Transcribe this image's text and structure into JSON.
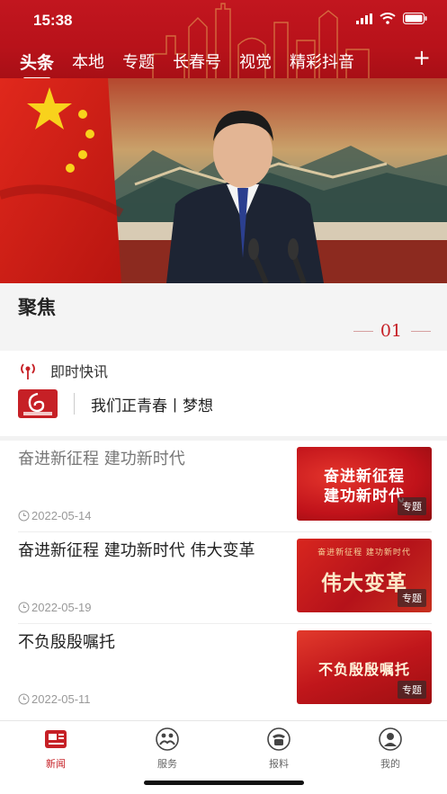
{
  "status_bar": {
    "time": "15:38"
  },
  "header": {
    "tabs": [
      "头条",
      "本地",
      "专题",
      "长春号",
      "视觉",
      "精彩抖音"
    ],
    "add_label": "+",
    "active_tab": "头条",
    "colors": {
      "brand_red": "#c2161f"
    }
  },
  "focus": {
    "title": "聚焦",
    "index": "01"
  },
  "flash": {
    "label": "即时快讯",
    "text": "我们正青春丨梦想"
  },
  "news": [
    {
      "title": "奋进新征程  建功新时代",
      "date": "2022-05-14",
      "thumb_line1": "奋进新征程",
      "thumb_line2": "建功新时代",
      "badge": "专题"
    },
    {
      "title": "奋进新征程  建功新时代  伟大变革",
      "date": "2022-05-19",
      "thumb_line1": "奋进新征程  建功新时代",
      "thumb_line2": "伟大变革",
      "badge": "专题"
    },
    {
      "title": "不负殷殷嘱托",
      "date": "2022-05-11",
      "thumb_line1": "不负殷殷嘱托",
      "thumb_line2": "",
      "badge": "专题"
    }
  ],
  "bottom_nav": [
    {
      "label": "新闻",
      "icon": "newspaper-icon"
    },
    {
      "label": "服务",
      "icon": "handshake-icon"
    },
    {
      "label": "报料",
      "icon": "phone-icon"
    },
    {
      "label": "我的",
      "icon": "user-icon"
    }
  ]
}
